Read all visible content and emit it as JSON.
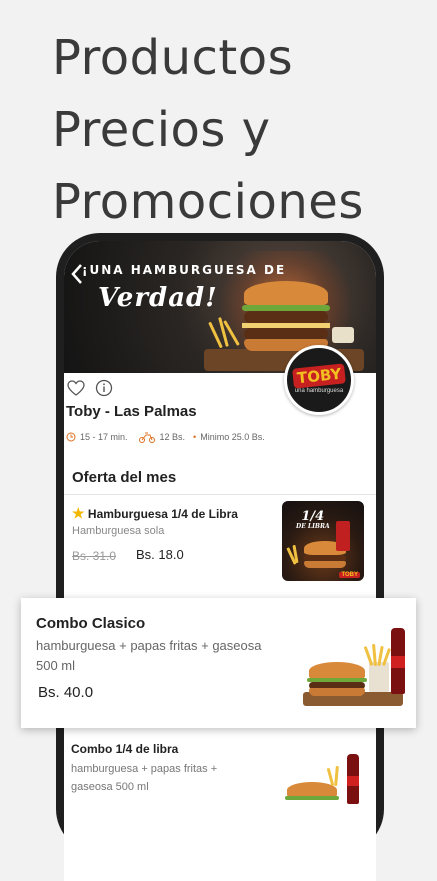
{
  "headline": {
    "line1": "Productos",
    "line2": "Precios y",
    "line3": "Promociones"
  },
  "banner": {
    "text1": "¡UNA HAMBURGUESA DE",
    "text2": "Verdad!",
    "back_icon": "chevron-left-icon"
  },
  "store": {
    "logo_text": "TOBY",
    "logo_subtext": "una hamburguesa",
    "name": "Toby - Las Palmas",
    "delivery_time": "15 - 17 min.",
    "delivery_fee": "12 Bs.",
    "minimum": "Minimo 25.0 Bs.",
    "accent_color": "#e07020"
  },
  "section": {
    "title": "Oferta del mes"
  },
  "products": [
    {
      "title": "Hamburguesa 1/4 de Libra",
      "description": "Hamburguesa sola",
      "old_price": "Bs. 31.0",
      "price": "Bs. 18.0",
      "image_text_line1": "1/4",
      "image_text_line2": "DE LIBRA",
      "image_brand": "TOBY"
    },
    {
      "title": "Combo Clasico",
      "description": "hamburguesa + papas fritas + gaseosa 500 ml",
      "price": "Bs. 40.0"
    },
    {
      "title": "Combo 1/4 de libra",
      "description": "hamburguesa + papas fritas + gaseosa 500 ml"
    }
  ]
}
